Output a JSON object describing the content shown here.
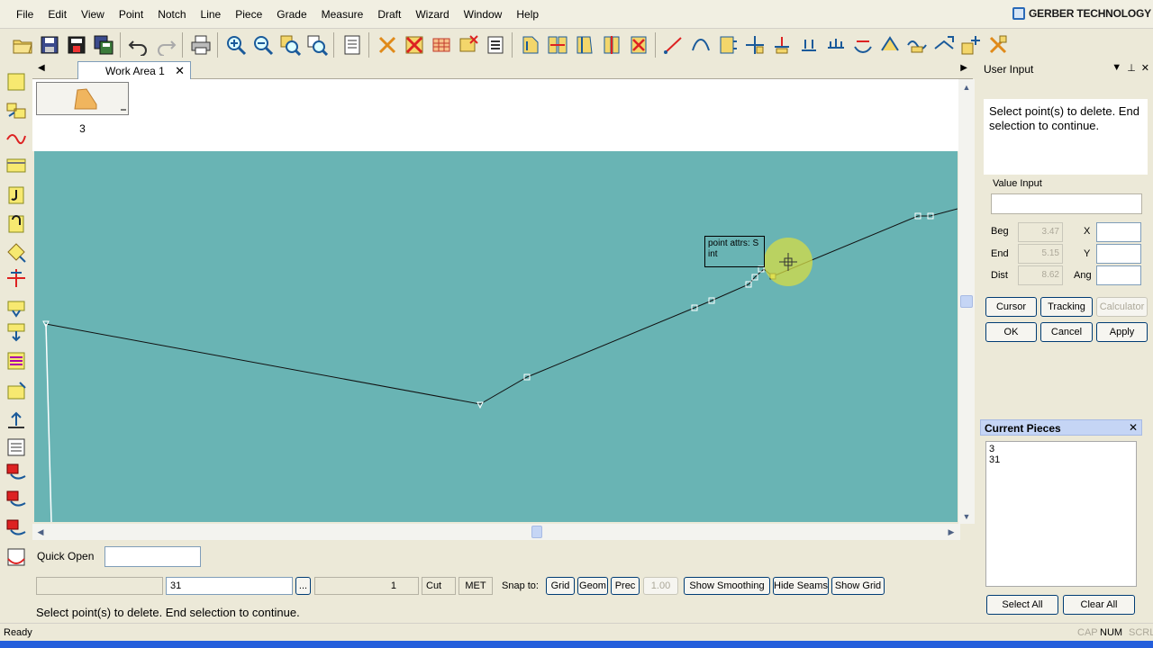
{
  "menu": {
    "items": [
      "File",
      "Edit",
      "View",
      "Point",
      "Notch",
      "Line",
      "Piece",
      "Grade",
      "Measure",
      "Draft",
      "Wizard",
      "Window",
      "Help"
    ],
    "brand": "GERBER TECHNOLOGY"
  },
  "tabs": {
    "work_area": "Work Area 1",
    "close": "✕",
    "left_arrow": "◀",
    "right_arrow": "▶"
  },
  "pieces_strip": {
    "thumb_label": "3"
  },
  "canvas": {
    "background": "#69b4b4",
    "tooltip_line1": "point attrs: S",
    "tooltip_line2": "int"
  },
  "bottom": {
    "quick_open_label": "Quick Open",
    "quick_open_value": "",
    "field_left": "",
    "piece_field": "31",
    "browse_button": "...",
    "count_field": "1",
    "cut_field": "Cut",
    "met_field": "MET",
    "snap_label": "Snap to:",
    "snap_grid": "Grid",
    "snap_geom": "Geom",
    "snap_prec": "Prec",
    "snap_value": "1.00",
    "show_smoothing": "Show Smoothing",
    "hide_seams": "Hide Seams",
    "show_grid": "Show Grid",
    "prompt": "Select point(s) to delete. End selection to continue."
  },
  "status": {
    "text": "Ready",
    "cap": "CAP",
    "num": "NUM",
    "scrl": "SCRL"
  },
  "user_input": {
    "title": "User Input",
    "prompt": "Select point(s) to delete. End selection to continue.",
    "value_input_label": "Value Input",
    "value_input": "",
    "beg_label": "Beg",
    "beg_value": "3.47",
    "end_label": "End",
    "end_value": "5.15",
    "dist_label": "Dist",
    "dist_value": "8.62",
    "x_label": "X",
    "y_label": "Y",
    "ang_label": "Ang",
    "cursor_btn": "Cursor",
    "tracking_btn": "Tracking",
    "calculator_btn": "Calculator",
    "ok_btn": "OK",
    "cancel_btn": "Cancel",
    "apply_btn": "Apply"
  },
  "current_pieces": {
    "title": "Current Pieces",
    "close": "✕",
    "items": [
      "3",
      "31"
    ],
    "select_all": "Select All",
    "clear_all": "Clear All"
  },
  "colors": {
    "accent_blue": "#2a6ab8",
    "canvas": "#69b4b4",
    "piece_fill": "#f0b55e",
    "highlight": "#d6dc46"
  },
  "icons": {
    "toolbar": [
      "open-icon",
      "save-icon",
      "save-as-icon",
      "save-all-icon",
      "undo-icon",
      "redo-icon",
      "print-icon",
      "zoom-in-icon",
      "zoom-out-icon",
      "zoom-window-icon",
      "zoom-fit-icon",
      "properties-icon",
      "delete-icon",
      "delete-all-icon",
      "grid-icon",
      "mark-icon",
      "list-icon",
      "piece-tool-icon",
      "line-tool-icon",
      "curve-tool-icon",
      "notch-tool-icon",
      "point-tool-icon"
    ],
    "left": [
      "piece-icon",
      "open-piece-icon",
      "line-icon",
      "fill-icon",
      "hook-icon",
      "point-add-icon",
      "cross-icon",
      "notch-icon",
      "measure-icon",
      "table-icon",
      "grade-icon"
    ]
  }
}
